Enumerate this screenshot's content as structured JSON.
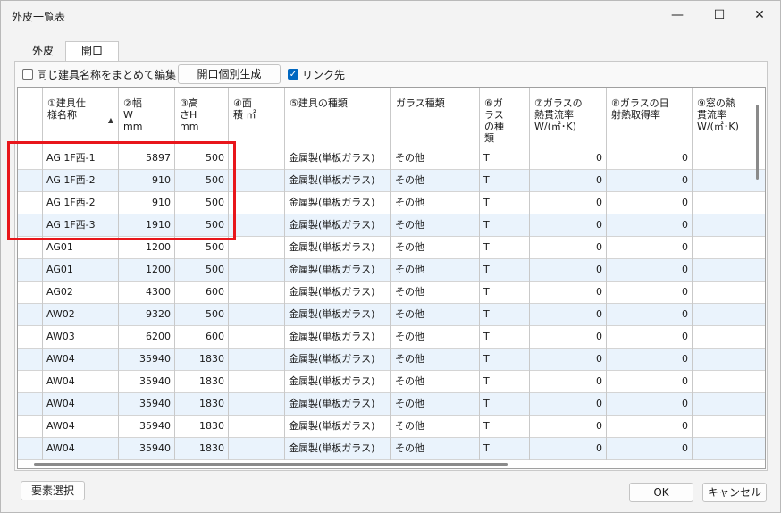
{
  "window": {
    "title": "外皮一覧表",
    "minimize": "—",
    "maximize": "☐",
    "close": "✕"
  },
  "tabs": [
    {
      "label": "外皮",
      "active": false
    },
    {
      "label": "開口",
      "active": true
    }
  ],
  "toolbar": {
    "merge_label": "同じ建具名称をまとめて編集",
    "merge_checked": false,
    "generate_label": "開口個別生成",
    "link_label": "リンク先",
    "link_checked": true
  },
  "table": {
    "headers": [
      "",
      "①建具仕\n様名称",
      "②幅\nW\nmm",
      "③高\nさH\nmm",
      "④面\n積 ㎡",
      "⑤建具の種類",
      "ガラス種類",
      "⑥ガ\nラス\nの種\n類",
      "⑦ガラスの\n熱貫流率\nW/(㎡･K)",
      "⑧ガラスの日\n射熱取得率",
      "⑨窓の熱\n貫流率\nW/(㎡･K)"
    ],
    "sort_indicator": "▲",
    "rows": [
      [
        "",
        "AG 1F西-1",
        "5897",
        "500",
        "",
        "金属製(単板ガラス)",
        "その他",
        "T",
        "0",
        "0",
        ""
      ],
      [
        "",
        "AG 1F西-2",
        "910",
        "500",
        "",
        "金属製(単板ガラス)",
        "その他",
        "T",
        "0",
        "0",
        ""
      ],
      [
        "",
        "AG 1F西-2",
        "910",
        "500",
        "",
        "金属製(単板ガラス)",
        "その他",
        "T",
        "0",
        "0",
        ""
      ],
      [
        "",
        "AG 1F西-3",
        "1910",
        "500",
        "",
        "金属製(単板ガラス)",
        "その他",
        "T",
        "0",
        "0",
        ""
      ],
      [
        "",
        "AG01",
        "1200",
        "500",
        "",
        "金属製(単板ガラス)",
        "その他",
        "T",
        "0",
        "0",
        ""
      ],
      [
        "",
        "AG01",
        "1200",
        "500",
        "",
        "金属製(単板ガラス)",
        "その他",
        "T",
        "0",
        "0",
        ""
      ],
      [
        "",
        "AG02",
        "4300",
        "600",
        "",
        "金属製(単板ガラス)",
        "その他",
        "T",
        "0",
        "0",
        ""
      ],
      [
        "",
        "AW02",
        "9320",
        "500",
        "",
        "金属製(単板ガラス)",
        "その他",
        "T",
        "0",
        "0",
        ""
      ],
      [
        "",
        "AW03",
        "6200",
        "600",
        "",
        "金属製(単板ガラス)",
        "その他",
        "T",
        "0",
        "0",
        ""
      ],
      [
        "",
        "AW04",
        "35940",
        "1830",
        "",
        "金属製(単板ガラス)",
        "その他",
        "T",
        "0",
        "0",
        ""
      ],
      [
        "",
        "AW04",
        "35940",
        "1830",
        "",
        "金属製(単板ガラス)",
        "その他",
        "T",
        "0",
        "0",
        ""
      ],
      [
        "",
        "AW04",
        "35940",
        "1830",
        "",
        "金属製(単板ガラス)",
        "その他",
        "T",
        "0",
        "0",
        ""
      ],
      [
        "",
        "AW04",
        "35940",
        "1830",
        "",
        "金属製(単板ガラス)",
        "その他",
        "T",
        "0",
        "0",
        ""
      ],
      [
        "",
        "AW04",
        "35940",
        "1830",
        "",
        "金属製(単板ガラス)",
        "その他",
        "T",
        "0",
        "0",
        ""
      ]
    ]
  },
  "footer": {
    "select_label": "要素選択",
    "ok_label": "OK",
    "cancel_label": "キャンセル"
  },
  "colors": {
    "highlight": "#e8161b",
    "alt_row": "#eaf3fc",
    "checkbox_on": "#0067c0"
  }
}
